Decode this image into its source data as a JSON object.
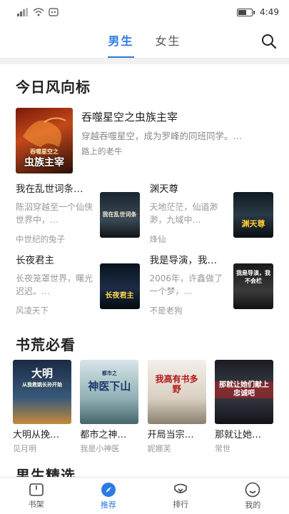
{
  "status": {
    "time": "4:49"
  },
  "header": {
    "tabs": [
      {
        "label": "男生",
        "active": true
      },
      {
        "label": "女生",
        "active": false
      }
    ]
  },
  "section1": {
    "title": "今日风向标",
    "feature": {
      "title": "吞噬星空之虫族主宰",
      "desc": "穿越吞噬星空，成为罗峰的同班同学。…",
      "author": "路上的老牛",
      "cover_text": "虫族主宰",
      "cover_sub": "吞噬星空之"
    },
    "items": [
      {
        "title": "我在乱世词条…",
        "desc": "陈泅穿越至一个仙侠世界中，…",
        "author": "中世纪的兔子",
        "cover_text": "我在乱世词条"
      },
      {
        "title": "渊天尊",
        "desc": "天地茫茫，仙道渺渺，九域中…",
        "author": "烽仙",
        "cover_text": "渊天尊"
      },
      {
        "title": "长夜君主",
        "desc": "长夜笼罩世界，曙光迟迟。…",
        "author": "风凌天下",
        "cover_text": "长夜君主"
      },
      {
        "title": "我是导演，我…",
        "desc": "2006年，许鑫做了一个梦，…",
        "author": "不是老狗",
        "cover_text": "我是导演，我不会栏"
      }
    ]
  },
  "section2": {
    "title": "书荒必看",
    "books": [
      {
        "title": "大明从挽…",
        "author": "见月明",
        "cover_text": "大明",
        "cover_sub": "从挽救姚长孙开始"
      },
      {
        "title": "都市之神…",
        "author": "我是小神医",
        "cover_text": "神医下山",
        "cover_sub": "都市之"
      },
      {
        "title": "开局当宗…",
        "author": "妮娜芙",
        "cover_text": "我高有书多野",
        "cover_sub": ""
      },
      {
        "title": "那就让她…",
        "author": "常世",
        "cover_text": "那就让她们献上忠诚吧",
        "cover_sub": ""
      }
    ]
  },
  "section3": {
    "title": "男生精选"
  },
  "bottom_nav": [
    {
      "label": "书架",
      "icon": "bookshelf-icon",
      "active": false
    },
    {
      "label": "推荐",
      "icon": "compass-icon",
      "active": true
    },
    {
      "label": "排行",
      "icon": "ranking-icon",
      "active": false
    },
    {
      "label": "我的",
      "icon": "profile-icon",
      "active": false
    }
  ]
}
